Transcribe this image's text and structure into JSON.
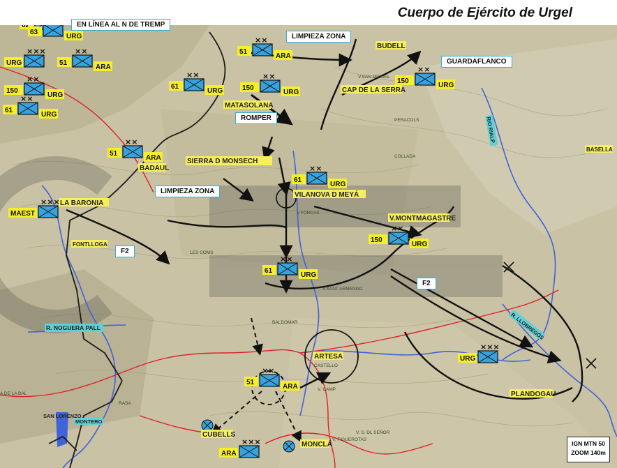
{
  "title": "Cuerpo de Ejército de Urgel",
  "callouts": {
    "linea_tremp": "EN LÍNEA AL N DE TREMP",
    "limpieza_zona_top": "LIMPIEZA ZONA",
    "guardaflanco": "GUARDAFLANCO",
    "romper": "ROMPER",
    "limpieza_zona_mid": "LIMPIEZA ZONA",
    "f2_left": "F2",
    "f2_right": "F2"
  },
  "legend": {
    "line1": "IGN MTN 50",
    "line2": "ZOOM 140m"
  },
  "units": [
    {
      "num": "62",
      "tag": "",
      "echelon": "××"
    },
    {
      "num": "63",
      "tag": "URG",
      "echelon": "××"
    },
    {
      "num": "URG",
      "tag": "",
      "echelon": "×××"
    },
    {
      "num": "51",
      "tag": "ARA",
      "echelon": "××"
    },
    {
      "num": "150",
      "tag": "URG",
      "echelon": "××"
    },
    {
      "num": "61",
      "tag": "URG",
      "echelon": "××"
    },
    {
      "num": "51",
      "tag": "ARA",
      "echelon": "××"
    },
    {
      "num": "61",
      "tag": "URG",
      "echelon": "××"
    },
    {
      "num": "150",
      "tag": "URG",
      "echelon": "××"
    },
    {
      "num": "150",
      "tag": "URG",
      "echelon": "××"
    },
    {
      "num": "51",
      "tag": "ARA",
      "echelon": "××"
    },
    {
      "num": "61",
      "tag": "URG",
      "echelon": "××"
    },
    {
      "num": "MAEST",
      "tag": "",
      "echelon": "×××"
    },
    {
      "num": "150",
      "tag": "URG",
      "echelon": "××"
    },
    {
      "num": "61",
      "tag": "URG",
      "echelon": "××"
    },
    {
      "num": "URG",
      "tag": "",
      "echelon": "×××"
    },
    {
      "num": "51",
      "tag": "ARA",
      "echelon": "××"
    },
    {
      "num": "ARA",
      "tag": "",
      "echelon": "×××"
    }
  ],
  "places": {
    "budell": "BUDELL",
    "cap_serra": "CAP DE LA SERRA",
    "matasolana": "MATASOLANA",
    "sierra_monsech": "SIERRA D MONSECH",
    "badaul": "BADAUL",
    "vilanova": "VILANOVA D MEYÁ",
    "la_baronia": "LA BARONIA",
    "montmagastre": "V.MONTMAGASTRE",
    "fontlloga": "FONTLLOGA",
    "nogurra": "R. NOGUERA PALL",
    "artesa": "ARTESA",
    "plandogau": "PLANDOGAU",
    "basella": "BASELLA",
    "rio_rialp": "RIO RIALP",
    "llobregos": "R. LLOBREGÓS",
    "cubells": "CUBELLS",
    "mongla": "MONCLÁ",
    "montero": "MONTERO",
    "san_lorenzo": "SAN LORENZO"
  },
  "map_text": {
    "san_miguel": "V.SAN MIGUEL",
    "peracols": "PERACOLS",
    "collada": "COLLADA",
    "v_forcas": "V.FORCAS",
    "les_coms": "LES COMS",
    "s_arnaldo": "V.SANT ARMENDO",
    "baldomar": "BALDOMAR",
    "castell": "CASTELLO",
    "v_canfr": "V. CAMP",
    "s_dl_senor": "V. S. DL SEÑOR",
    "v_figuerota": "V. FIGUEROTAS",
    "la_bal": "A DE LA BAL",
    "rasa": "RASA"
  }
}
